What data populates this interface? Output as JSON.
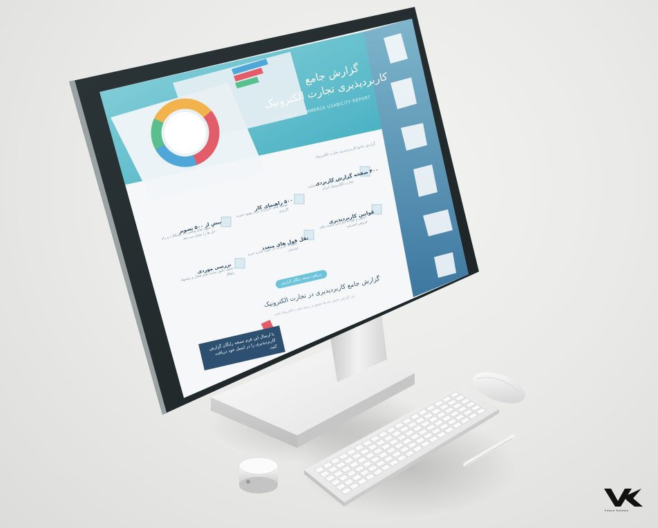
{
  "hero": {
    "title_line1": "گزارش جامع",
    "title_line2": "کاربردپذیری تجارت الکترونیک",
    "subtitle": "THE 2015 E-COMMERCE USABILITY REPORT"
  },
  "breadcrumb": "گزارش جامع کاربردپذیری تجارت الکترونیک",
  "features": [
    {
      "title": "۴۰۰ صفحه گزارش کاربردی",
      "desc": "سنجش کامل بیش از ۱۰۰ سایت تجارت الکترونیک ایران"
    },
    {
      "title": "۵۰۰ راهنمای کار",
      "desc": "توصیه های کاربردی برای بهبود تجربه کاربری"
    },
    {
      "title": "بیش از ۵۰۰ تصویر",
      "desc": "از نمونه های واقعی که مشکلات و راه حل ها را نشان می دهد"
    },
    {
      "title": "قوانین کاربردپذیری",
      "desc": "اصول و قواعد طراحی سایت های فروش اینترنتی"
    },
    {
      "title": "نقل قول های متعدد",
      "desc": "نظرات کاربران در مورد تجربه خرید اینترنتی"
    },
    {
      "title": "بررسی موردی",
      "desc": "تحلیل دقیق سایت های فعال و پیشنهاد راهکار"
    }
  ],
  "download_button": "دریافت نسخه رایگان گزارش",
  "section": {
    "title": "گزارش جامع کاربردپذیری در تجارت الکترونیک",
    "desc": "این گزارش حاصل ماه ها تحقیق در زمینه تجارت الکترونیک است"
  },
  "cta": {
    "text": "با ارسال این فرم نسخه رایگان گزارش کاربردپذیری را در ایمیل خود دریافت کنید."
  },
  "sidebar_icons": [
    "document-icon",
    "server-shield-icon",
    "monitor-icon",
    "settings-document-icon",
    "quote-icon",
    "chart-icon"
  ],
  "watermark": {
    "brand": "Future Solution"
  },
  "colors": {
    "teal": "#4fbfd0",
    "navy": "#2d5070",
    "sidebar": "#5a8fb0"
  }
}
